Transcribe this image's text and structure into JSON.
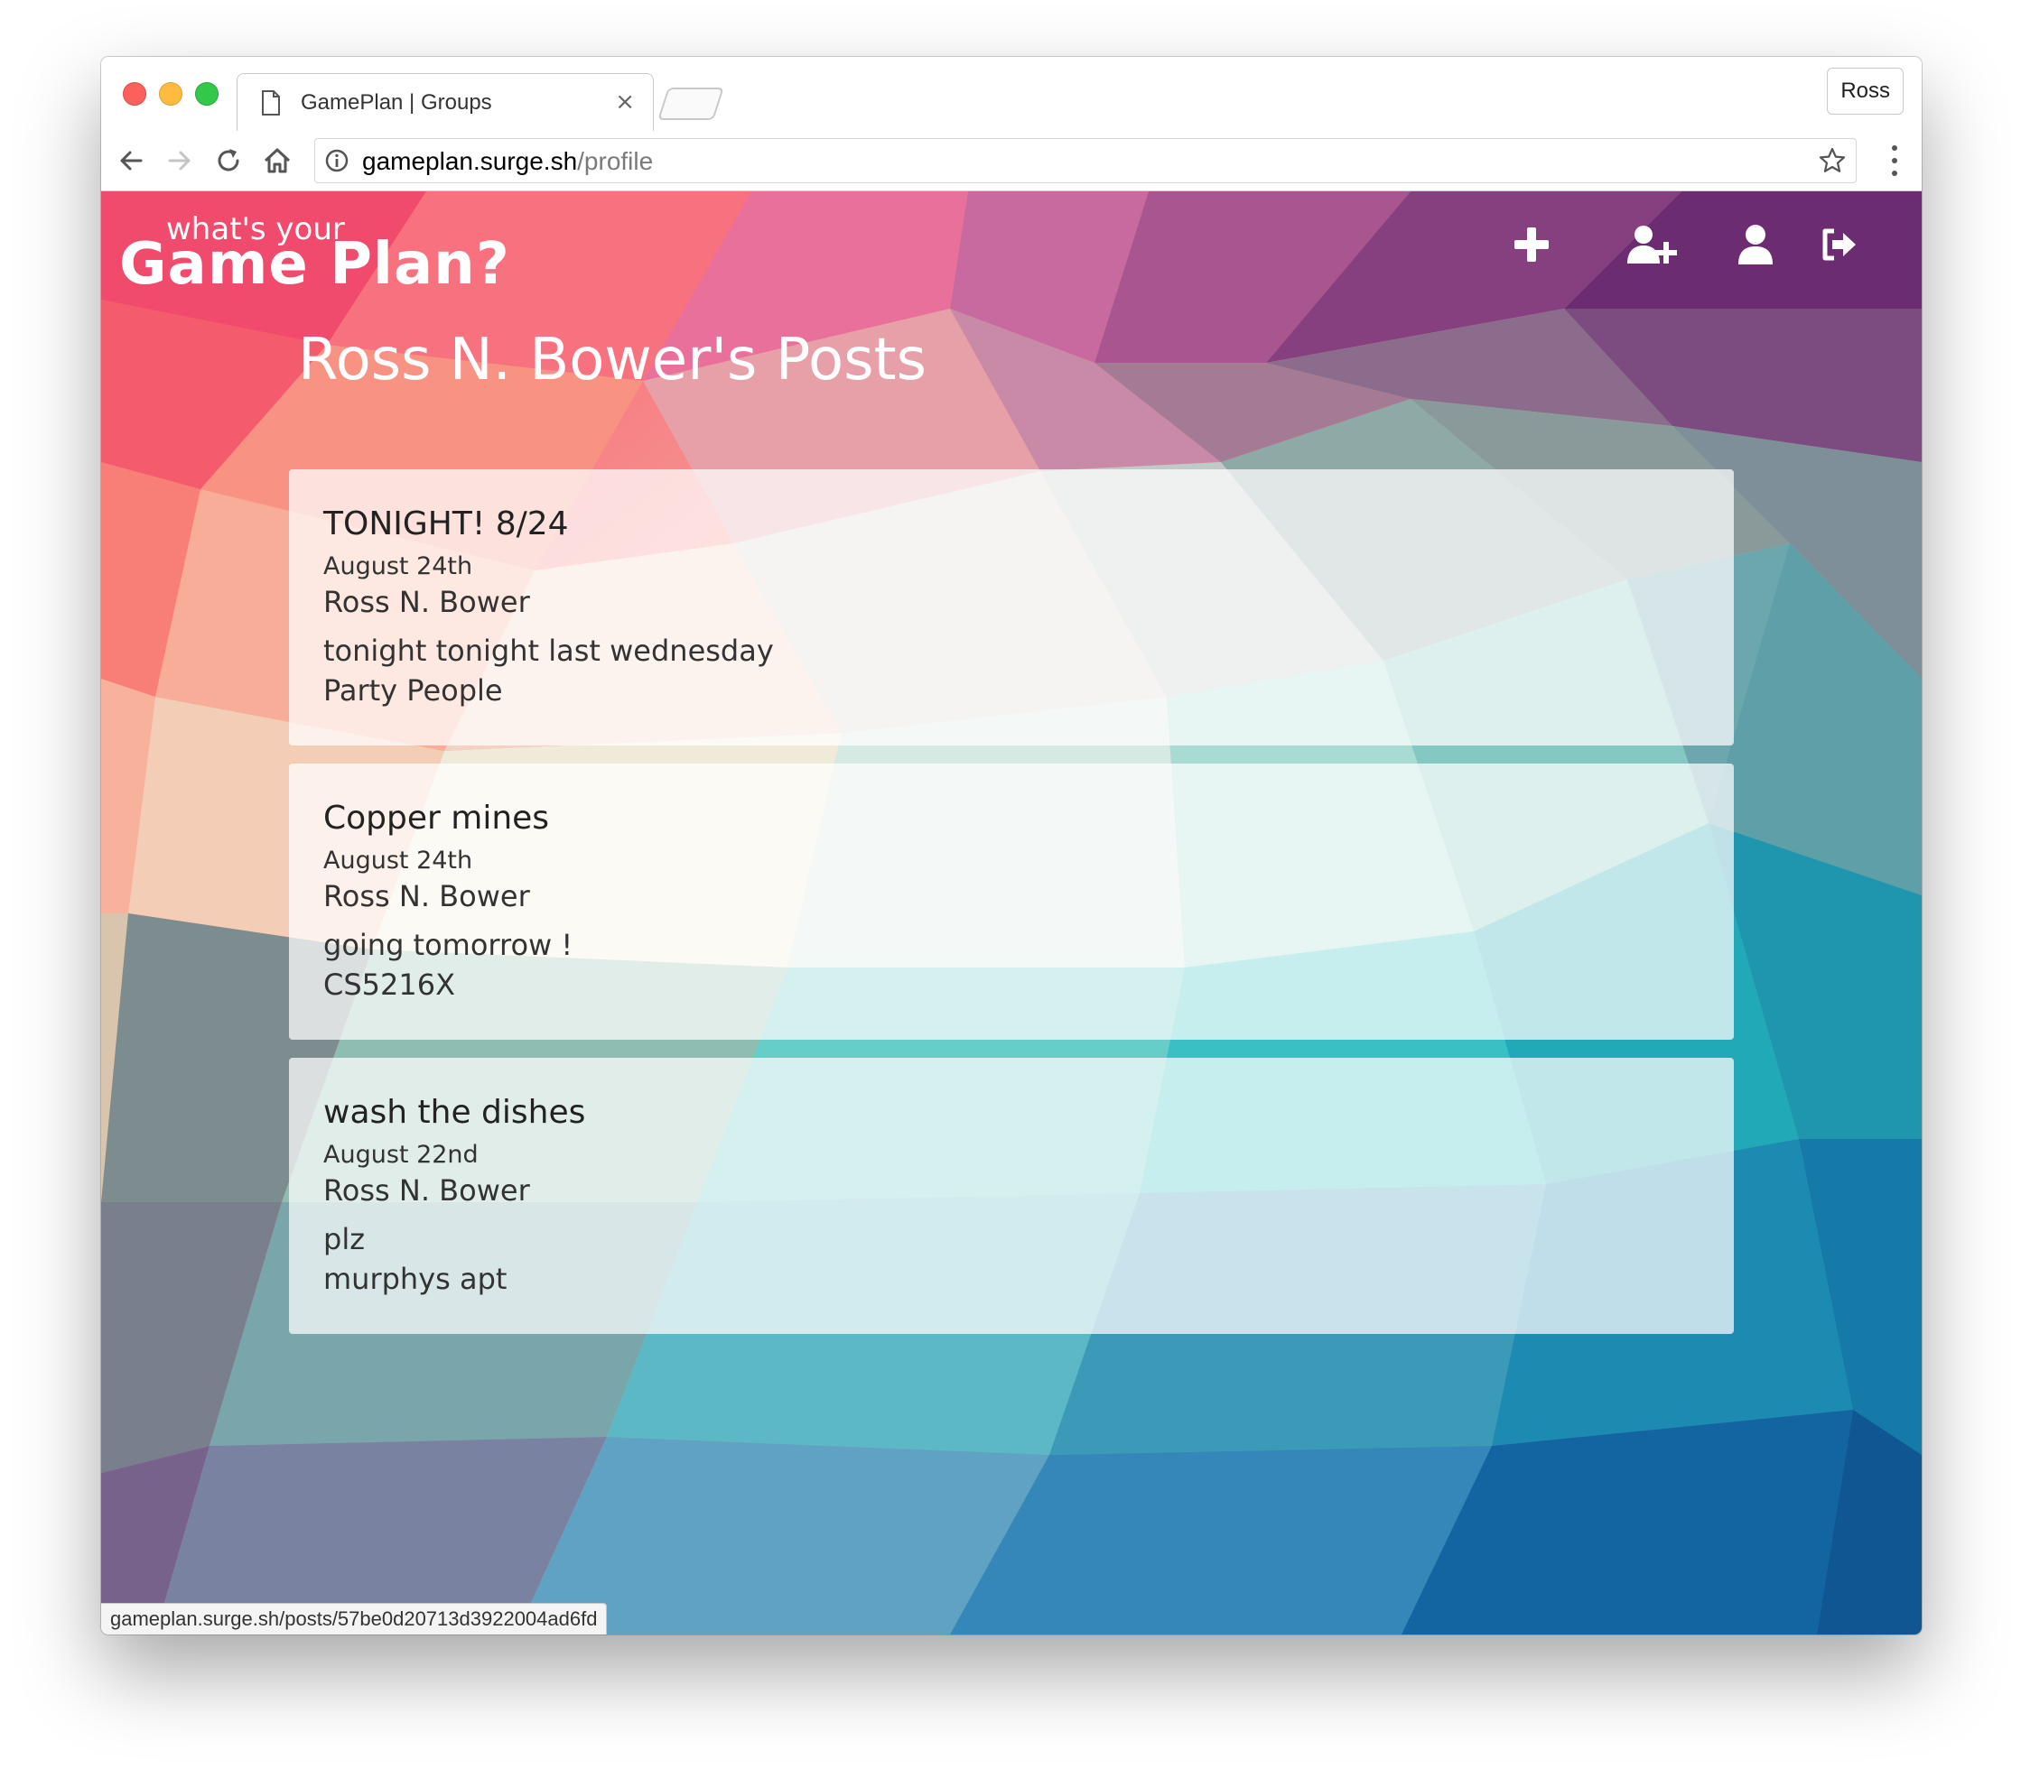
{
  "browser": {
    "tab_title": "GamePlan | Groups",
    "tab_close": "×",
    "profile_name": "Ross",
    "url_host": "gameplan.surge.sh",
    "url_path": "/profile",
    "status_url": "gameplan.surge.sh/posts/57be0d20713d3922004ad6fd"
  },
  "header": {
    "logo_small": "what's your",
    "logo_big": "Game Plan?",
    "nav_icons": [
      "plus-icon",
      "add-user-icon",
      "user-icon",
      "sign-out-icon"
    ]
  },
  "main": {
    "title": "Ross N. Bower's Posts",
    "posts": [
      {
        "title": "TONIGHT! 8/24",
        "date": "August 24th",
        "author": "Ross N. Bower",
        "description": "tonight tonight last wednesday",
        "group": "Party People"
      },
      {
        "title": "Copper mines",
        "date": "August 24th",
        "author": "Ross N. Bower",
        "description": "going tomorrow !",
        "group": "CS5216X"
      },
      {
        "title": "wash the dishes",
        "date": "August 22nd",
        "author": "Ross N. Bower",
        "description": "plz",
        "group": "murphys apt"
      }
    ]
  },
  "colors": {
    "card_background": "#ffffffb8",
    "header_text": "#ffffff",
    "post_text": "#333333"
  }
}
